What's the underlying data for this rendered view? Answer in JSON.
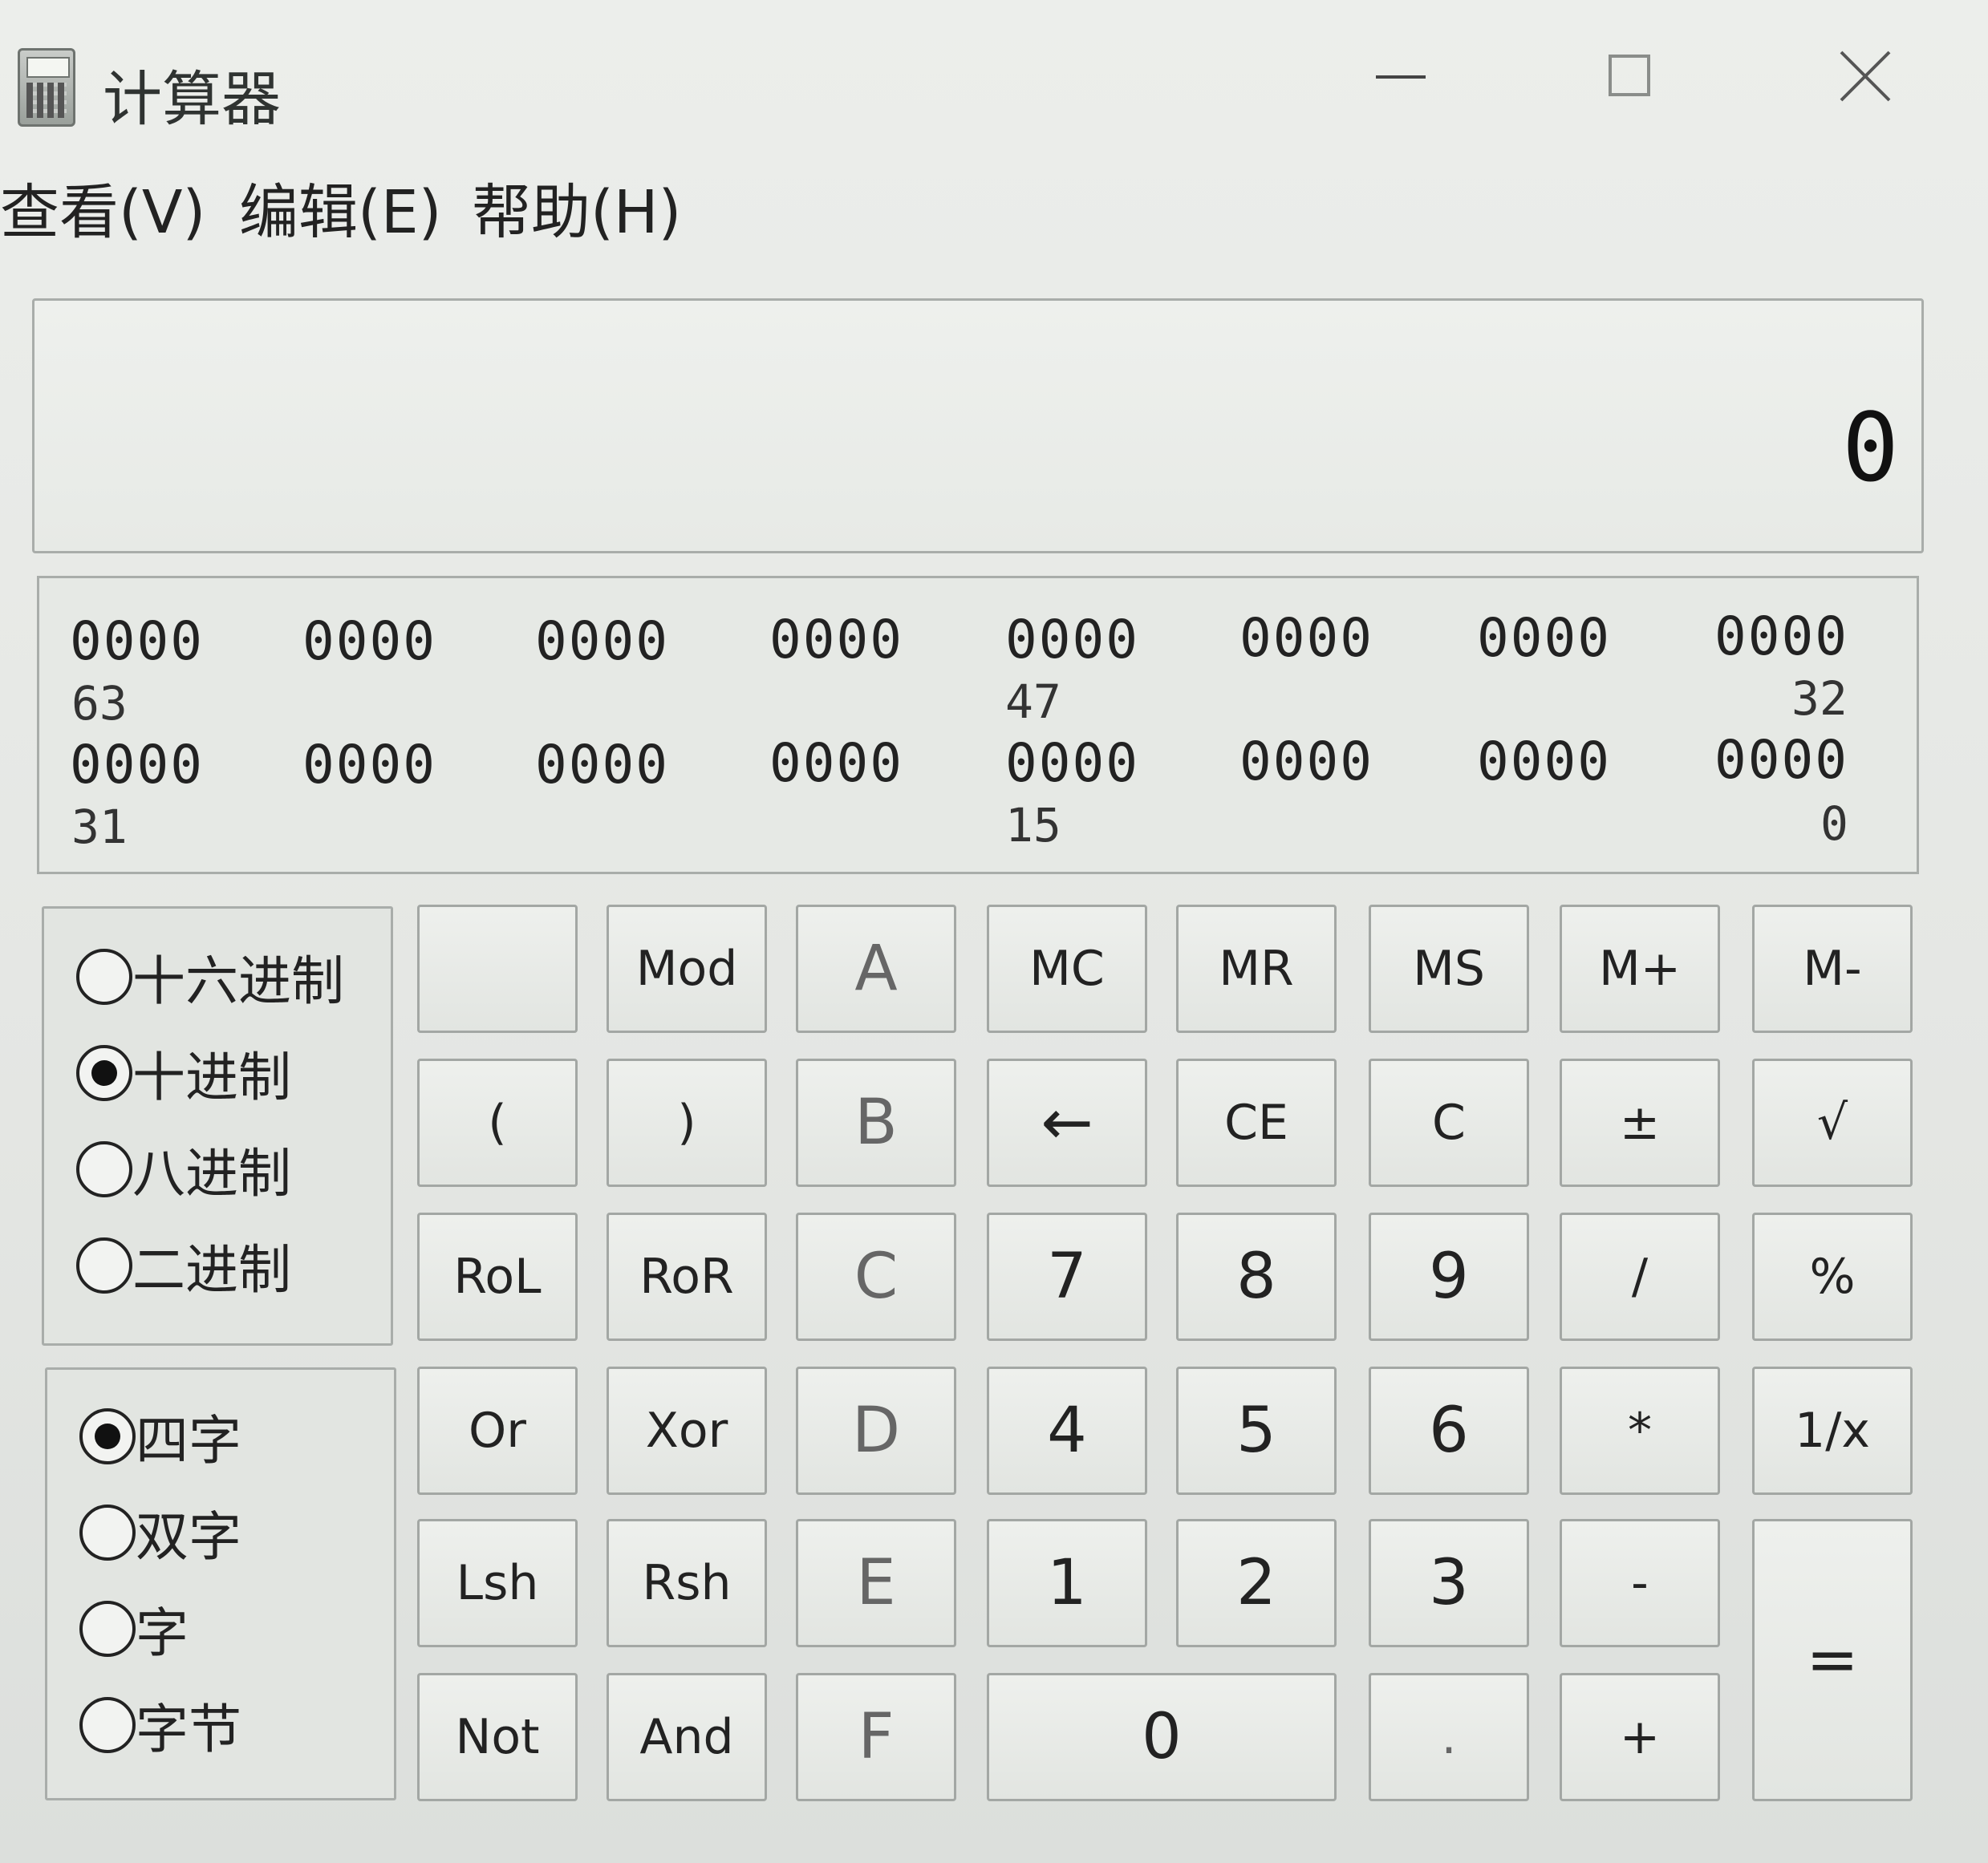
{
  "window": {
    "title": "计算器",
    "icon": "calculator-icon",
    "controls": [
      "minimize-icon",
      "maximize-icon",
      "close-icon"
    ]
  },
  "menu": {
    "view": "查看(V)",
    "edit": "编辑(E)",
    "help": "帮助(H)"
  },
  "display": {
    "value": "0"
  },
  "bits": {
    "row1_groups": [
      "0000",
      "0000",
      "0000",
      "0000",
      "0000",
      "0000",
      "0000",
      "0000"
    ],
    "row1_labels": [
      "63",
      "47",
      "32"
    ],
    "row2_groups": [
      "0000",
      "0000",
      "0000",
      "0000",
      "0000",
      "0000",
      "0000",
      "0000"
    ],
    "row2_labels": [
      "31",
      "15",
      "0"
    ]
  },
  "base": {
    "options": [
      "十六进制",
      "十进制",
      "八进制",
      "二进制"
    ],
    "selected": "十进制"
  },
  "word": {
    "options": [
      "四字",
      "双字",
      "字",
      "字节"
    ],
    "selected": "四字"
  },
  "keys": {
    "blank": "",
    "mod": "Mod",
    "a": "A",
    "mc": "MC",
    "mr": "MR",
    "ms": "MS",
    "mplus": "M+",
    "mminus": "M-",
    "lparen": "(",
    "rparen": ")",
    "b": "B",
    "backspace": "←",
    "ce": "CE",
    "c_clear": "C",
    "plusminus": "±",
    "sqrt": "√",
    "rol": "RoL",
    "ror": "RoR",
    "c_hex": "C",
    "d7": "7",
    "d8": "8",
    "d9": "9",
    "divide": "/",
    "percent": "%",
    "or": "Or",
    "xor": "Xor",
    "d_hex": "D",
    "d4": "4",
    "d5": "5",
    "d6": "6",
    "multiply": "*",
    "reciprocal": "1/x",
    "lsh": "Lsh",
    "rsh": "Rsh",
    "e_hex": "E",
    "d1": "1",
    "d2": "2",
    "d3": "3",
    "minus": "-",
    "equals": "=",
    "not": "Not",
    "and": "And",
    "f_hex": "F",
    "d0": "0",
    "dot": ".",
    "plus": "+"
  }
}
